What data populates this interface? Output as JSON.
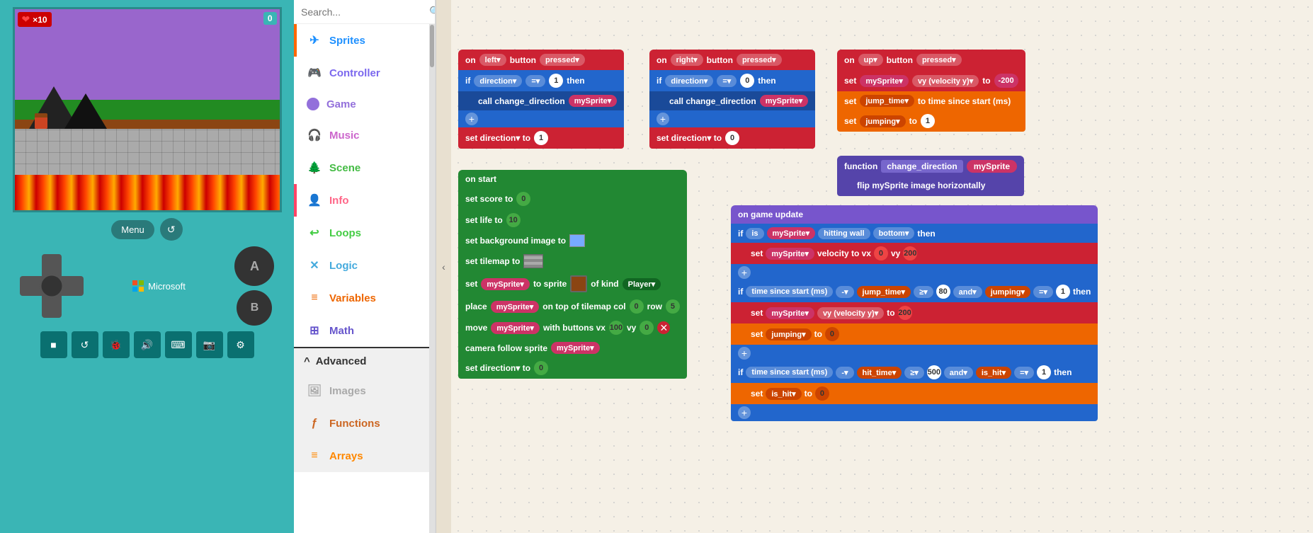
{
  "leftPanel": {
    "hud": {
      "hearts": "❤×10",
      "score": "0"
    },
    "menuBtn": "Menu",
    "btnA": "A",
    "btnB": "B",
    "microsoftLabel": "Microsoft",
    "toolbar": {
      "stop": "■",
      "refresh": "↺",
      "debug": "🐞",
      "sound": "🔊",
      "keyboard": "⌨",
      "screenshot": "📷",
      "settings": "⚙"
    }
  },
  "sidebar": {
    "search": {
      "placeholder": "Search...",
      "icon": "🔍"
    },
    "categories": [
      {
        "id": "sprites",
        "label": "Sprites",
        "icon": "✈",
        "color": "#1e90ff"
      },
      {
        "id": "controller",
        "label": "Controller",
        "icon": "🎮",
        "color": "#7b68ee"
      },
      {
        "id": "game",
        "label": "Game",
        "icon": "●",
        "color": "#9370db"
      },
      {
        "id": "music",
        "label": "Music",
        "icon": "🎧",
        "color": "#cc66cc"
      },
      {
        "id": "scene",
        "label": "Scene",
        "icon": "🌲",
        "color": "#44bb44"
      },
      {
        "id": "info",
        "label": "Info",
        "icon": "👤",
        "color": "#ff6688"
      },
      {
        "id": "loops",
        "label": "Loops",
        "icon": "↩",
        "color": "#44cc44"
      },
      {
        "id": "logic",
        "label": "Logic",
        "icon": "✕",
        "color": "#44aadd"
      },
      {
        "id": "variables",
        "label": "Variables",
        "icon": "≡",
        "color": "#ee6600"
      },
      {
        "id": "math",
        "label": "Math",
        "icon": "⊞",
        "color": "#6655cc"
      }
    ],
    "advanced": {
      "label": "Advanced",
      "icon": "^",
      "items": [
        {
          "id": "images",
          "label": "Images",
          "icon": "🖼",
          "color": "#aaa"
        },
        {
          "id": "functions",
          "label": "Functions",
          "icon": "ƒ",
          "color": "#cc6622"
        },
        {
          "id": "arrays",
          "label": "Arrays",
          "icon": "≡",
          "color": "#ff8800"
        }
      ]
    }
  },
  "workspace": {
    "onLeft": {
      "hat": "on  left▾  button pressed▾",
      "if": "if",
      "direction": "direction▾",
      "eq": "=▾",
      "val1": "1",
      "then": "then",
      "call": "call change_direction",
      "mySprite": "mySprite▾",
      "set": "set direction▾  to",
      "setVal": "1"
    },
    "onRight": {
      "hat": "on  right▾  button pressed▾",
      "if": "if",
      "direction": "direction▾",
      "eq": "=▾",
      "val0": "0",
      "then": "then",
      "call": "call change_direction",
      "mySprite": "mySprite▾",
      "set": "set direction▾  to",
      "setVal": "0"
    },
    "onUp": {
      "hat": "on  up▾  button pressed▾",
      "set1": "set  mySprite▾  vy (velocity y)▾  to",
      "val1": "-200",
      "set2": "set  jump_time▾  to  time since start (ms)",
      "set3": "set  jumping▾  to",
      "val3": "1"
    },
    "onStart": {
      "hat": "on start",
      "setScore": "set score to",
      "scoreVal": "0",
      "setLife": "set life to",
      "lifeVal": "10",
      "setBg": "set background image to",
      "setTilemap": "set tilemap to",
      "setSprite": "set  mySprite▾  to  sprite",
      "ofKind": "of kind Player▾",
      "place": "place  mySprite▾  on top of tilemap col",
      "col": "0",
      "row": "row",
      "rowVal": "5",
      "move": "move  mySprite▾  with buttons vx",
      "vxVal": "100",
      "vy": "vy",
      "vyVal": "0",
      "camera": "camera follow sprite  mySprite▾",
      "setDir": "set direction▾  to",
      "dirVal": "0"
    },
    "functionBlock": {
      "label": "function",
      "name": "change_direction",
      "param": "mySprite",
      "body": "flip  mySprite  image  horizontally"
    },
    "onGameUpdate": {
      "hat": "on game update",
      "if1": "if  is  mySprite▾  hitting wall bottom▾  then",
      "set1a": "set  mySprite▾  velocity to vx",
      "vx": "0",
      "vy": "vy",
      "vyVal": "200",
      "if2": "if  time since start (ms)  -▾  jump_time▾  ≥▾  80  and▾  jumping▾  =▾  1  then",
      "set2a": "set  mySprite▾  vy (velocity y)▾  to",
      "vy2": "200",
      "set2b": "set  jumping▾  to",
      "jumping": "0",
      "if3": "if  time since start (ms)  -▾  hit_time▾  ≥▾  500  and▾  is_hit▾  =▾  1  then",
      "set3": "set  is_hit▾  to",
      "isHitVal": "0"
    }
  }
}
